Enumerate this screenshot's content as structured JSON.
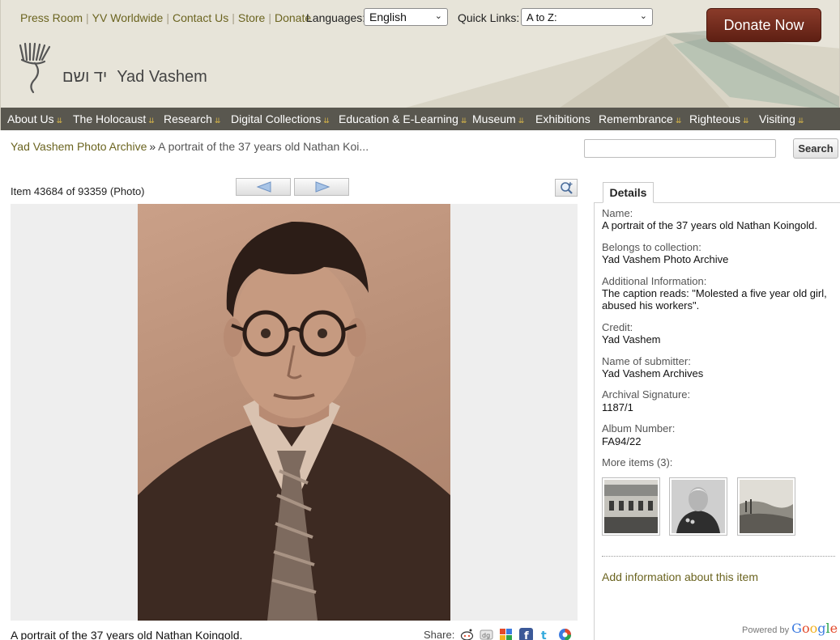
{
  "header": {
    "toplinks": [
      "Press Room",
      "YV Worldwide",
      "Contact Us",
      "Store",
      "Donate"
    ],
    "languages_label": "Languages:",
    "language_selected": "English",
    "quicklinks_label": "Quick Links:",
    "quicklinks_selected": "A to Z:",
    "donate_label": "Donate Now",
    "logo_hebrew": "יד ושם",
    "logo_text": "Yad Vashem"
  },
  "nav": [
    "About Us",
    "The Holocaust",
    "Research",
    "Digital Collections",
    "Education & E-Learning",
    "Museum",
    "Exhibitions",
    "Remembrance",
    "Righteous",
    "Visiting"
  ],
  "breadcrumb": {
    "root": "Yad Vashem Photo Archive",
    "separator": "»",
    "current": "A portrait of the 37 years old Nathan Koi..."
  },
  "search": {
    "button_label": "Search",
    "value": ""
  },
  "item": {
    "counter": "Item 43684 of 93359 (Photo)"
  },
  "photo": {
    "caption": "A portrait of the 37 years old Nathan Koingold."
  },
  "share": {
    "label": "Share:",
    "icons": [
      "reddit-icon",
      "digg-icon",
      "google-icon",
      "facebook-icon",
      "twitter-icon",
      "share-more-icon"
    ]
  },
  "details": {
    "tab_label": "Details",
    "fields": [
      {
        "label": "Name:",
        "value": "A portrait of the 37 years old Nathan Koingold."
      },
      {
        "label": "Belongs to collection:",
        "value": "Yad Vashem Photo Archive"
      },
      {
        "label": "Additional Information:",
        "value": "The caption reads: \"Molested a five year old girl, abused his workers\"."
      },
      {
        "label": "Credit:",
        "value": "Yad Vashem"
      },
      {
        "label": "Name of submitter:",
        "value": "Yad Vashem Archives"
      },
      {
        "label": "Archival Signature:",
        "value": "1187/1"
      },
      {
        "label": "Album Number:",
        "value": "FA94/22"
      }
    ],
    "more_items_label": "More items (3):",
    "add_info_link": "Add information about this item",
    "powered_by": "Powered by",
    "powered_brand": "Google"
  },
  "colors": {
    "header_bg": "#e7e4d9",
    "nav_bg": "#59574f",
    "link_olive": "#6b6420",
    "donate_bg": "#6e2a1b",
    "nav_arrow": "#d6b54a"
  }
}
